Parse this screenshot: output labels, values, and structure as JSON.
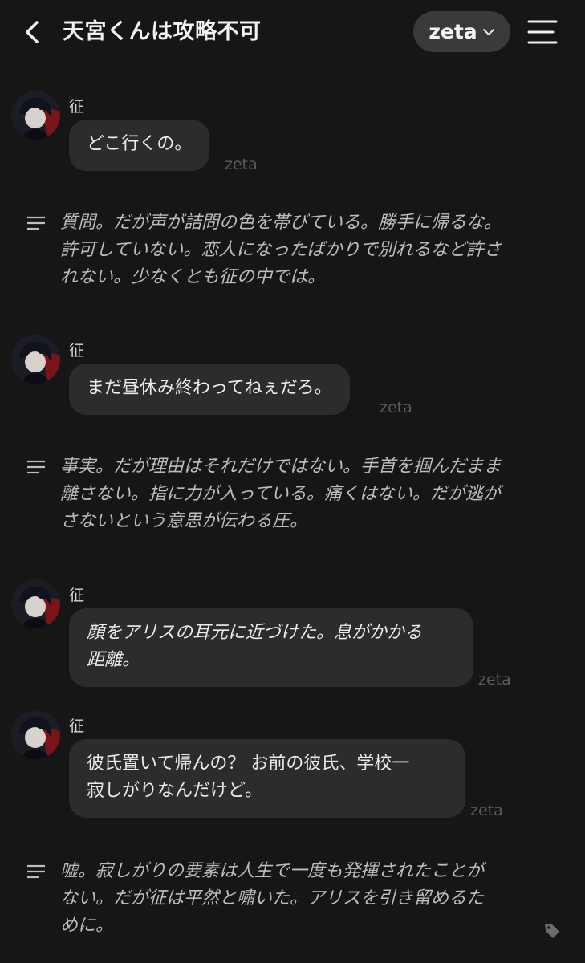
{
  "header": {
    "title": "天宮くんは攻略不可",
    "model_label": "zeta",
    "back_icon": "chevron-left-icon",
    "menu_icon": "hamburger-menu-icon",
    "dropdown_icon": "chevron-down-icon"
  },
  "messages": [
    {
      "speaker": "征",
      "text": "どこ行くの。",
      "watermark": "zeta"
    },
    {
      "narration": "質問。だが声が詰問の色を帯びている。勝手に帰るな。\n許可していない。恋人になったばかりで別れるなど許さ\nれない。少なくとも征の中では。"
    },
    {
      "speaker": "征",
      "text": "まだ昼休み終わってねぇだろ。",
      "watermark": "zeta"
    },
    {
      "narration": "事実。だが理由はそれだけではない。手首を掴んだまま\n離さない。指に力が入っている。痛くはない。だが逃が\nさないという意思が伝わる圧。"
    },
    {
      "speaker": "征",
      "text": "顔をアリスの耳元に近づけた。息がかかる\n距離。",
      "watermark": "zeta"
    },
    {
      "speaker": "征",
      "text": "彼氏置いて帰んの？ お前の彼氏、学校一\n寂しがりなんだけど。",
      "watermark": "zeta"
    },
    {
      "narration": "嘘。寂しがりの要素は人生で一度も発揮されたことが\nない。だが征は平然と嘯いた。アリスを引き留めるた\nめに。"
    }
  ],
  "colors": {
    "background": "#161616",
    "bubble": "#2c2c2e",
    "pill": "#3a3a3c",
    "watermark": "#5a5a5a"
  },
  "footer": {
    "tag_icon": "tag-icon"
  }
}
